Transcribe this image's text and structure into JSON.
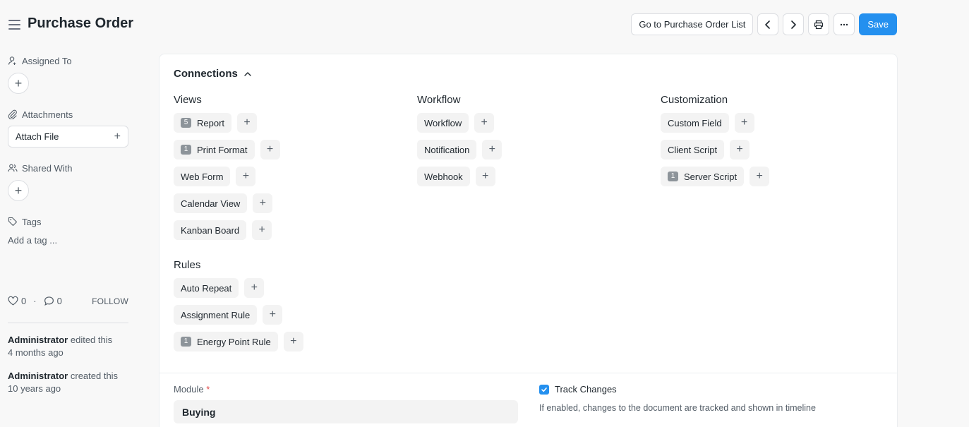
{
  "header": {
    "title": "Purchase Order",
    "go_to_list": "Go to Purchase Order List",
    "save": "Save"
  },
  "sidebar": {
    "assigned_to": "Assigned To",
    "attachments": "Attachments",
    "attach_file": "Attach File",
    "shared_with": "Shared With",
    "tags": "Tags",
    "add_tag": "Add a tag ...",
    "likes": "0",
    "comments": "0",
    "dot": "·",
    "follow": "FOLLOW",
    "activity": [
      {
        "user": "Administrator",
        "action": "edited this",
        "time": "4 months ago"
      },
      {
        "user": "Administrator",
        "action": "created this",
        "time": "10 years ago"
      }
    ]
  },
  "connections": {
    "title": "Connections",
    "views": {
      "heading": "Views",
      "items": [
        {
          "label": "Report",
          "count": "5"
        },
        {
          "label": "Print Format",
          "count": "1"
        },
        {
          "label": "Web Form"
        },
        {
          "label": "Calendar View"
        },
        {
          "label": "Kanban Board"
        }
      ]
    },
    "rules": {
      "heading": "Rules",
      "items": [
        {
          "label": "Auto Repeat"
        },
        {
          "label": "Assignment Rule"
        },
        {
          "label": "Energy Point Rule",
          "count": "1"
        }
      ]
    },
    "workflow": {
      "heading": "Workflow",
      "items": [
        {
          "label": "Workflow"
        },
        {
          "label": "Notification"
        },
        {
          "label": "Webhook"
        }
      ]
    },
    "customization": {
      "heading": "Customization",
      "items": [
        {
          "label": "Custom Field"
        },
        {
          "label": "Client Script"
        },
        {
          "label": "Server Script",
          "count": "1"
        }
      ]
    }
  },
  "form": {
    "module_label": "Module",
    "module_required": "*",
    "module_value": "Buying",
    "track_changes_label": "Track Changes",
    "track_changes_desc": "If enabled, changes to the document are tracked and shown in timeline"
  },
  "colors": {
    "primary": "#2490ef",
    "required": "#e24c4c"
  }
}
